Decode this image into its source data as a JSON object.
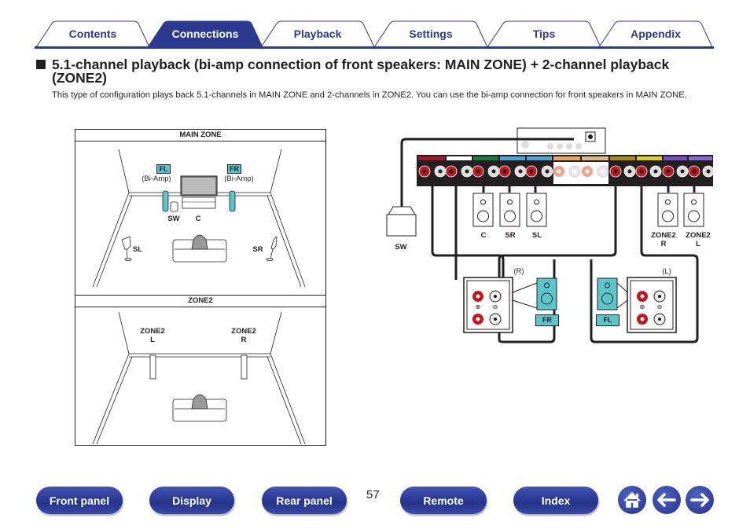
{
  "tabs": [
    {
      "label": "Contents",
      "active": false
    },
    {
      "label": "Connections",
      "active": true
    },
    {
      "label": "Playback",
      "active": false
    },
    {
      "label": "Settings",
      "active": false
    },
    {
      "label": "Tips",
      "active": false
    },
    {
      "label": "Appendix",
      "active": false
    }
  ],
  "heading": {
    "line1": "5.1-channel playback (bi-amp connection of front speakers: MAIN ZONE) + 2-channel playback",
    "line2": "(ZONE2)"
  },
  "description": "This type of configuration plays back 5.1-channels in MAIN ZONE and 2-channels in ZONE2. You can use the bi-amp connection for front speakers in MAIN ZONE.",
  "room_diagram": {
    "main_zone": {
      "title": "MAIN ZONE",
      "fl_tag": "FL",
      "fr_tag": "FR",
      "biamp_left": "(Bi-Amp)",
      "biamp_right": "(Bi-Amp)",
      "sw": "SW",
      "c": "C",
      "sl": "SL",
      "sr": "SR"
    },
    "zone2": {
      "title": "ZONE2",
      "left_line1": "ZONE2",
      "left_line2": "L",
      "right_line1": "ZONE2",
      "right_line2": "R"
    }
  },
  "wiring_diagram": {
    "sw": "SW",
    "c": "C",
    "sr": "SR",
    "sl": "SL",
    "zone2r_line1": "ZONE2",
    "zone2r_line2": "R",
    "zone2l_line1": "ZONE2",
    "zone2l_line2": "L",
    "r_label": "(R)",
    "l_label": "(L)",
    "fr_tag": "FR",
    "fl_tag": "FL",
    "plus": "⊕",
    "minus": "⊖"
  },
  "footer": {
    "buttons": [
      "Front panel",
      "Display",
      "Rear panel",
      "Remote",
      "Index"
    ],
    "page_number": "57",
    "icons": [
      "home-icon",
      "back-arrow-icon",
      "forward-arrow-icon"
    ]
  },
  "colors": {
    "brand_blue": "#2b3a8f",
    "speaker_cyan": "#5bc4cc",
    "terminal_red": "#c4161c"
  }
}
